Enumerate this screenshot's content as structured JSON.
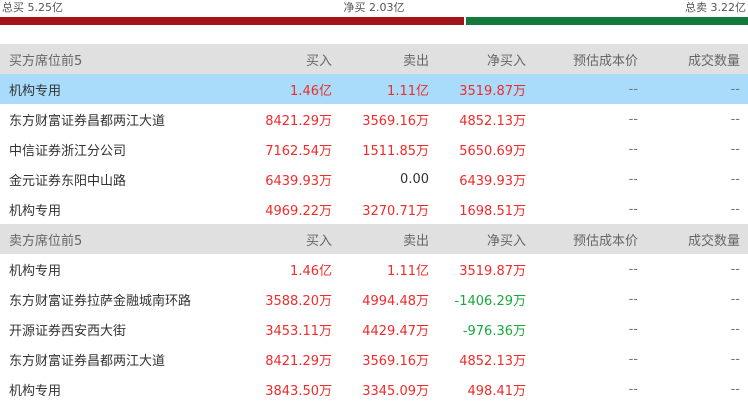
{
  "summary": {
    "total_buy": "总买 5.25亿",
    "net_buy": "净买 2.03亿",
    "total_sell": "总卖 3.22亿",
    "buy_ratio": 0.62,
    "buy_color": "#a51418",
    "sell_color": "#127a3a"
  },
  "colors": {
    "up": "#f02b2b",
    "down": "#18a83c",
    "highlight": "#a8dcfa",
    "header_bg": "#e0e0e0"
  },
  "buy_section": {
    "headers": [
      "买方席位前5",
      "买入",
      "卖出",
      "净买入",
      "预估成本价",
      "成交数量"
    ],
    "rows": [
      {
        "name": "机构专用",
        "buy": "1.46亿",
        "sell": "1.11亿",
        "net": "3519.87万",
        "cost": "--",
        "qty": "--",
        "highlight": true
      },
      {
        "name": "东方财富证券昌都两江大道",
        "buy": "8421.29万",
        "sell": "3569.16万",
        "net": "4852.13万",
        "cost": "--",
        "qty": "--"
      },
      {
        "name": "中信证券浙江分公司",
        "buy": "7162.54万",
        "sell": "1511.85万",
        "net": "5650.69万",
        "cost": "--",
        "qty": "--"
      },
      {
        "name": "金元证券东阳中山路",
        "buy": "6439.93万",
        "sell": "0.00",
        "net": "6439.93万",
        "cost": "--",
        "qty": "--"
      },
      {
        "name": "机构专用",
        "buy": "4969.22万",
        "sell": "3270.71万",
        "net": "1698.51万",
        "cost": "--",
        "qty": "--"
      }
    ]
  },
  "sell_section": {
    "headers": [
      "卖方席位前5",
      "买入",
      "卖出",
      "净买入",
      "预估成本价",
      "成交数量"
    ],
    "rows": [
      {
        "name": "机构专用",
        "buy": "1.46亿",
        "sell": "1.11亿",
        "net": "3519.87万",
        "cost": "--",
        "qty": "--"
      },
      {
        "name": "东方财富证券拉萨金融城南环路",
        "buy": "3588.20万",
        "sell": "4994.48万",
        "net": "-1406.29万",
        "cost": "--",
        "qty": "--"
      },
      {
        "name": "开源证券西安西大街",
        "buy": "3453.11万",
        "sell": "4429.47万",
        "net": "-976.36万",
        "cost": "--",
        "qty": "--"
      },
      {
        "name": "东方财富证券昌都两江大道",
        "buy": "8421.29万",
        "sell": "3569.16万",
        "net": "4852.13万",
        "cost": "--",
        "qty": "--"
      },
      {
        "name": "机构专用",
        "buy": "3843.50万",
        "sell": "3345.09万",
        "net": "498.41万",
        "cost": "--",
        "qty": "--"
      }
    ]
  }
}
